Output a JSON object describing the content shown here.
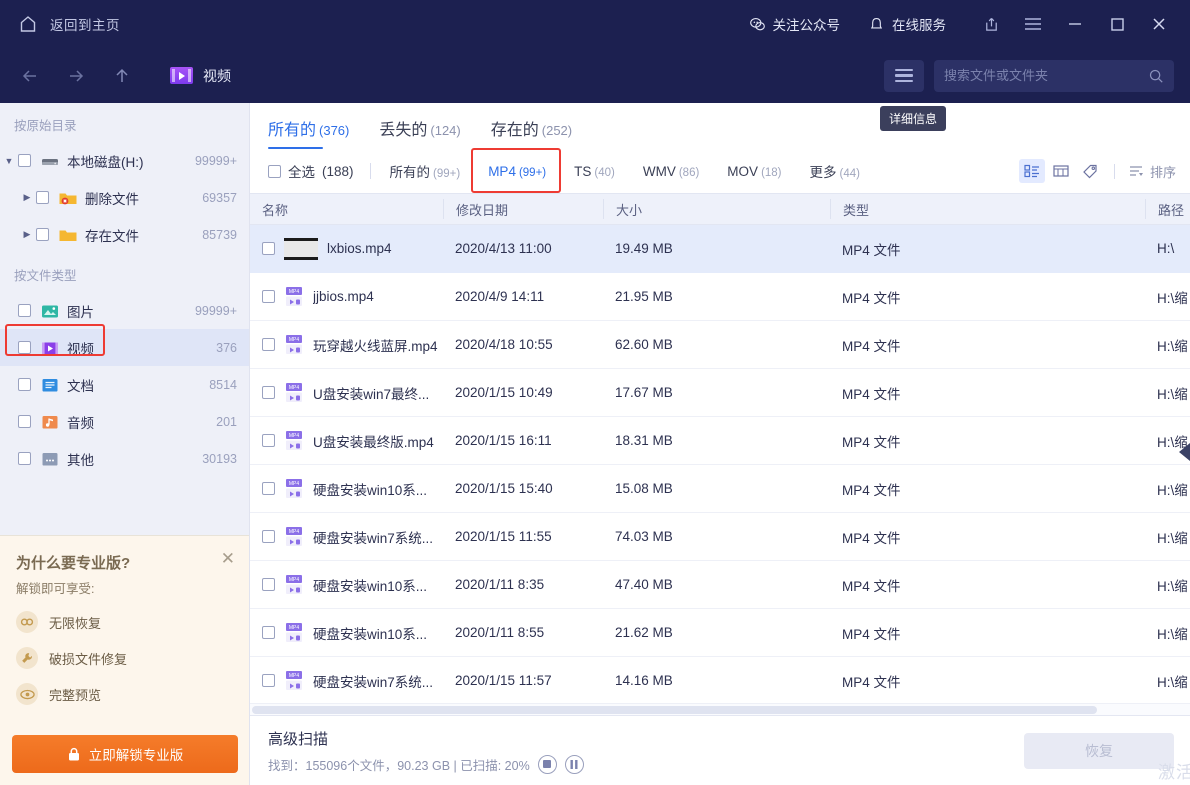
{
  "titlebar": {
    "home_label": "返回到主页",
    "home_icon": "home-icon",
    "wechat_label": "关注公众号",
    "wechat_icon": "chat-bubbles-icon",
    "service_label": "在线服务",
    "service_icon": "bell-icon",
    "share_icon": "share-upload-icon",
    "menu_icon": "hamburger-menu-icon",
    "minimize_icon": "minimize-icon",
    "maximize_icon": "maximize-icon",
    "close_icon": "close-icon"
  },
  "navbar": {
    "back_icon": "arrow-left-icon",
    "forward_icon": "arrow-right-icon",
    "up_icon": "arrow-up-icon",
    "breadcrumb_label": "视频",
    "breadcrumb_icon": "video-folder-icon",
    "details_button_icon": "hamburger-list-icon",
    "details_tooltip": "详细信息",
    "search_placeholder": "搜索文件或文件夹",
    "search_value": "",
    "search_icon": "search-icon"
  },
  "sidebar": {
    "section_origin": "按原始目录",
    "section_filetype": "按文件类型",
    "origin_items": [
      {
        "label": "本地磁盘(H:)",
        "count": "99999+",
        "icon": "hard-drive-icon",
        "twist": "▼",
        "indent": 0,
        "selected": false
      },
      {
        "label": "删除文件",
        "count": "69357",
        "icon": "deleted-folder-icon",
        "twist": "▶",
        "indent": 1,
        "selected": false
      },
      {
        "label": "存在文件",
        "count": "85739",
        "icon": "folder-icon",
        "twist": "▶",
        "indent": 1,
        "selected": false
      }
    ],
    "filetype_items": [
      {
        "label": "图片",
        "count": "99999+",
        "icon": "image-icon",
        "selected": false
      },
      {
        "label": "视频",
        "count": "376",
        "icon": "video-icon",
        "selected": true
      },
      {
        "label": "文档",
        "count": "8514",
        "icon": "document-icon",
        "selected": false
      },
      {
        "label": "音频",
        "count": "201",
        "icon": "audio-icon",
        "selected": false
      },
      {
        "label": "其他",
        "count": "30193",
        "icon": "other-files-icon",
        "selected": false
      }
    ],
    "promo": {
      "title": "为什么要专业版?",
      "subtitle": "解锁即可享受:",
      "close_icon": "close-icon",
      "features": [
        {
          "label": "无限恢复",
          "icon": "infinity-icon"
        },
        {
          "label": "破损文件修复",
          "icon": "wrench-icon"
        },
        {
          "label": "完整预览",
          "icon": "eye-icon"
        }
      ],
      "button_label": "立即解锁专业版",
      "button_icon": "lock-icon",
      "button_color": "#ef6c1a"
    }
  },
  "main": {
    "tabs": [
      {
        "label": "所有的",
        "count": "(376)",
        "active": true
      },
      {
        "label": "丢失的",
        "count": "(124)",
        "active": false
      },
      {
        "label": "存在的",
        "count": "(252)",
        "active": false
      }
    ],
    "select_all": {
      "label": "全选",
      "count": "(188)",
      "checked": false
    },
    "format_filters": [
      {
        "label": "所有的",
        "count": "(99+)",
        "active": false,
        "highlighted": false
      },
      {
        "label": "MP4",
        "count": "(99+)",
        "active": true,
        "highlighted": true
      },
      {
        "label": "TS",
        "count": "(40)",
        "active": false,
        "highlighted": false
      },
      {
        "label": "WMV",
        "count": "(86)",
        "active": false,
        "highlighted": false
      },
      {
        "label": "MOV",
        "count": "(18)",
        "active": false,
        "highlighted": false
      },
      {
        "label": "更多",
        "count": "(44)",
        "active": false,
        "highlighted": false
      }
    ],
    "view_buttons": [
      {
        "icon": "list-view-icon",
        "active": true
      },
      {
        "icon": "grid-view-icon",
        "active": false
      },
      {
        "icon": "tag-icon",
        "active": false
      }
    ],
    "sort": {
      "label": "排序",
      "icon": "sort-icon"
    },
    "columns": [
      "名称",
      "修改日期",
      "大小",
      "类型",
      "路径"
    ],
    "rows": [
      {
        "name": "lxbios.mp4",
        "date": "2020/4/13 11:00",
        "size": "19.49 MB",
        "type": "MP4 文件",
        "path": "H:\\",
        "icon": "video-thumbnail-icon",
        "selected": true
      },
      {
        "name": "jjbios.mp4",
        "date": "2020/4/9 14:11",
        "size": "21.95 MB",
        "type": "MP4 文件",
        "path": "H:\\缩",
        "icon": "mp4-file-icon",
        "selected": false
      },
      {
        "name": "玩穿越火线蓝屏.mp4",
        "date": "2020/4/18 10:55",
        "size": "62.60 MB",
        "type": "MP4 文件",
        "path": "H:\\缩",
        "icon": "mp4-file-icon",
        "selected": false
      },
      {
        "name": "U盘安装win7最终...",
        "date": "2020/1/15 10:49",
        "size": "17.67 MB",
        "type": "MP4 文件",
        "path": "H:\\缩",
        "icon": "mp4-file-icon",
        "selected": false
      },
      {
        "name": "U盘安装最终版.mp4",
        "date": "2020/1/15 16:11",
        "size": "18.31 MB",
        "type": "MP4 文件",
        "path": "H:\\缩",
        "icon": "mp4-file-icon",
        "selected": false
      },
      {
        "name": "硬盘安装win10系...",
        "date": "2020/1/15 15:40",
        "size": "15.08 MB",
        "type": "MP4 文件",
        "path": "H:\\缩",
        "icon": "mp4-file-icon",
        "selected": false
      },
      {
        "name": "硬盘安装win7系统...",
        "date": "2020/1/15 11:55",
        "size": "74.03 MB",
        "type": "MP4 文件",
        "path": "H:\\缩",
        "icon": "mp4-file-icon",
        "selected": false
      },
      {
        "name": "硬盘安装win10系...",
        "date": "2020/1/11 8:35",
        "size": "47.40 MB",
        "type": "MP4 文件",
        "path": "H:\\缩",
        "icon": "mp4-file-icon",
        "selected": false
      },
      {
        "name": "硬盘安装win10系...",
        "date": "2020/1/11 8:55",
        "size": "21.62 MB",
        "type": "MP4 文件",
        "path": "H:\\缩",
        "icon": "mp4-file-icon",
        "selected": false
      },
      {
        "name": "硬盘安装win7系统...",
        "date": "2020/1/15 11:57",
        "size": "14.16 MB",
        "type": "MP4 文件",
        "path": "H:\\缩",
        "icon": "mp4-file-icon",
        "selected": false
      }
    ]
  },
  "statusbar": {
    "title": "高级扫描",
    "info": "找到：155096个文件，90.23 GB | 已扫描: 20%",
    "stop_icon": "stop-icon",
    "pause_icon": "pause-icon",
    "recover_label": "恢复",
    "watermark": "激活"
  }
}
